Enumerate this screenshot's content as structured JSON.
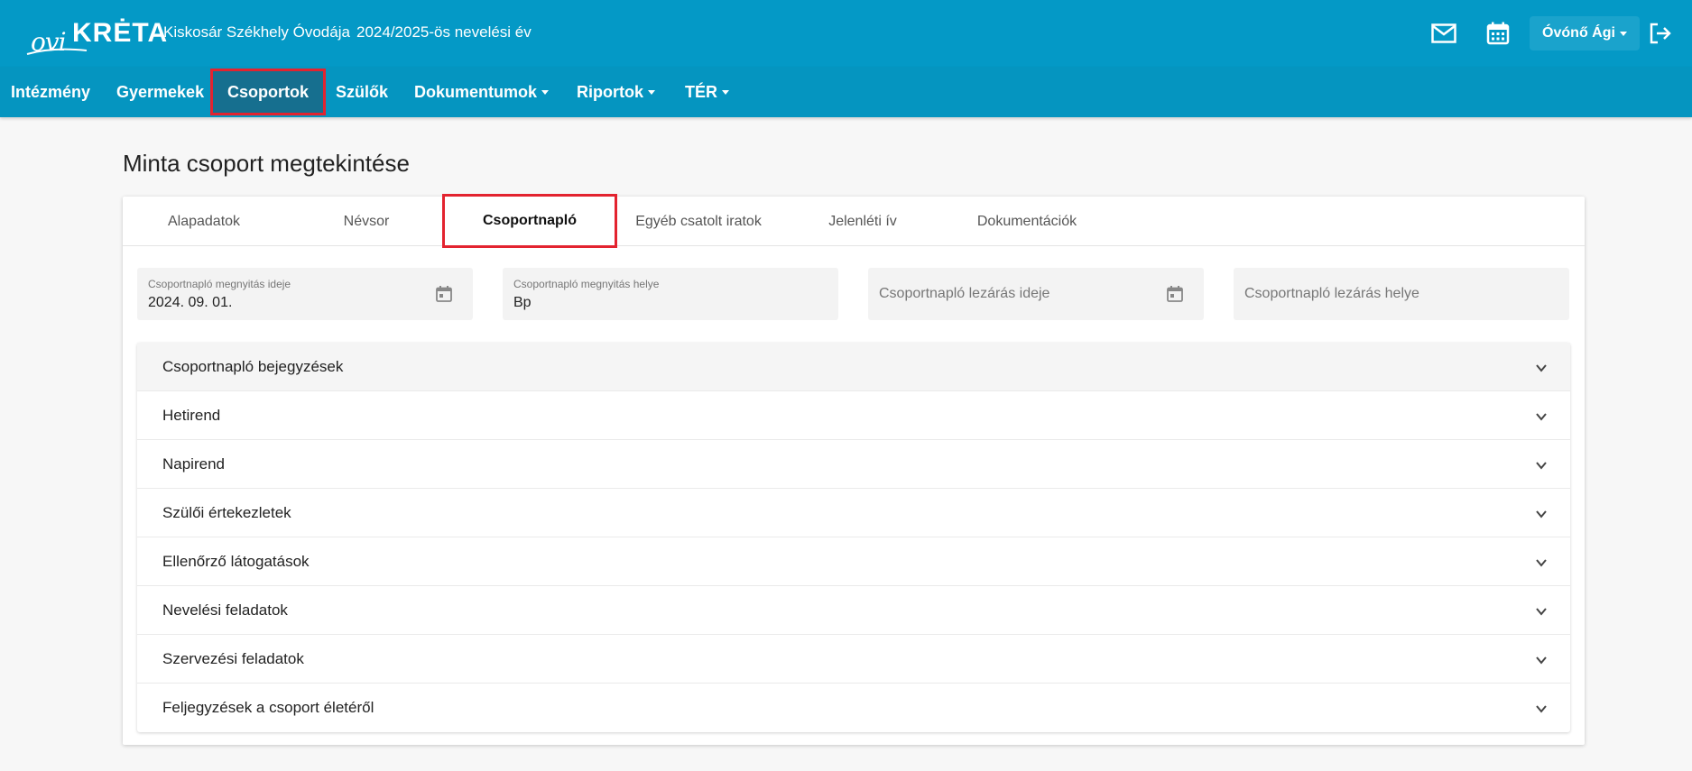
{
  "header": {
    "logo_ovi": "ovi",
    "logo_kreta": "KRĖTA",
    "school": "Kiskosár Székhely Óvodája",
    "year": "2024/2025-ös nevelési év",
    "user_label": "Óvónő Ági",
    "icons": [
      "mail-icon",
      "calendar-icon",
      "logout-icon"
    ],
    "brand_color": "#0499c6"
  },
  "nav": {
    "items": [
      {
        "label": "Intézmény"
      },
      {
        "label": "Gyermekek"
      },
      {
        "label": "Csoportok",
        "active": true
      },
      {
        "label": "Szülők"
      },
      {
        "label": "Dokumentumok",
        "dropdown": true
      },
      {
        "label": "Riportok",
        "dropdown": true
      },
      {
        "label": "TÉR",
        "dropdown": true
      }
    ]
  },
  "page": {
    "title": "Minta csoport megtekintése"
  },
  "tabs": [
    {
      "label": "Alapadatok"
    },
    {
      "label": "Névsor"
    },
    {
      "label": "Csoportnapló",
      "active": true
    },
    {
      "label": "Egyéb csatolt iratok"
    },
    {
      "label": "Jelenléti ív"
    },
    {
      "label": "Dokumentációk"
    }
  ],
  "fields": {
    "open_date": {
      "label": "Csoportnapló megnyitás ideje",
      "value": "2024. 09. 01."
    },
    "open_place": {
      "label": "Csoportnapló megnyitás helye",
      "value": "Bp"
    },
    "close_date": {
      "placeholder": "Csoportnapló lezárás ideje"
    },
    "close_place": {
      "placeholder": "Csoportnapló lezárás helye"
    }
  },
  "accordion": [
    {
      "label": "Csoportnapló bejegyzések"
    },
    {
      "label": "Hetirend"
    },
    {
      "label": "Napirend"
    },
    {
      "label": "Szülői értekezletek"
    },
    {
      "label": "Ellenőrző látogatások"
    },
    {
      "label": "Nevelési feladatok"
    },
    {
      "label": "Szervezési feladatok"
    },
    {
      "label": "Feljegyzések a csoport életéről"
    }
  ]
}
